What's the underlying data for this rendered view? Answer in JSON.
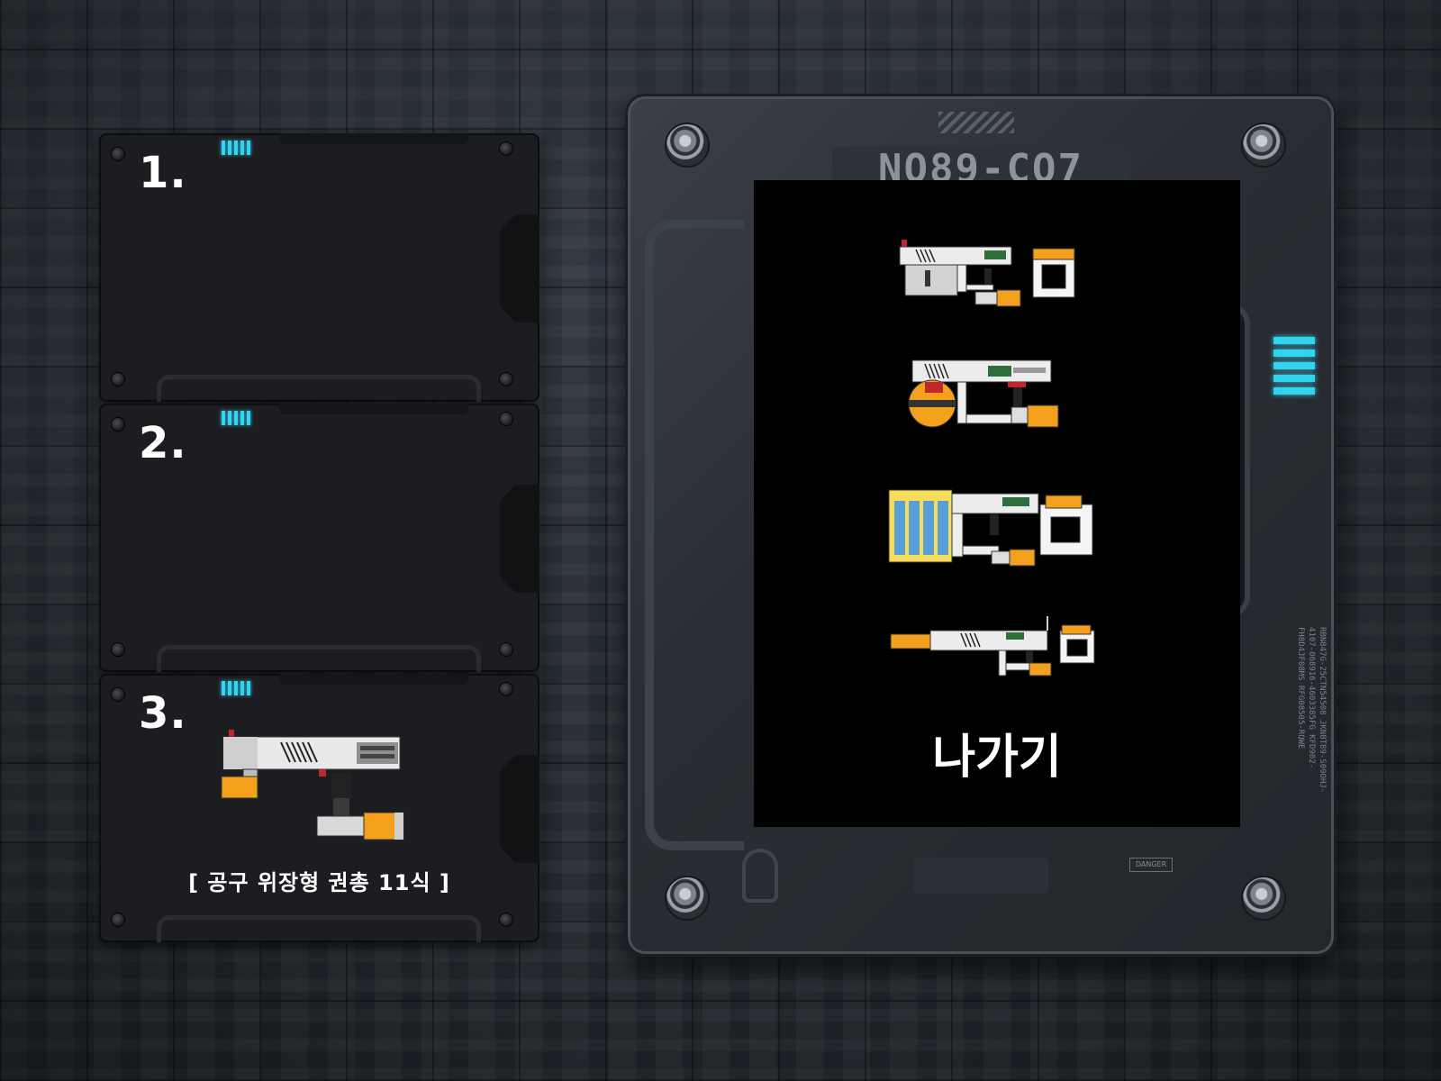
{
  "slots": [
    {
      "number": "1.",
      "caption": ""
    },
    {
      "number": "2.",
      "caption": ""
    },
    {
      "number": "3.",
      "caption": "[ 공구 위장형 권총 11식 ]"
    }
  ],
  "device": {
    "code": "NO89-CO7",
    "danger_label": "DANGER",
    "serial_text": "RBN847G-25CTN54508 JKN8T89-S09OHJ-4107-068916-4603385FG KFD902-FH8D4JF08MS RFG08505-RQWE"
  },
  "menu": {
    "weapons": [
      {
        "name": "weapon-1"
      },
      {
        "name": "weapon-2"
      },
      {
        "name": "weapon-3"
      },
      {
        "name": "weapon-4"
      }
    ],
    "exit_label": "나가기"
  },
  "colors": {
    "accent_led": "#33d3ef",
    "weapon_orange": "#f3a11d",
    "screen_bg": "#000000"
  },
  "icons": {
    "slot_screw": "screw-icon",
    "led": "led-indicator-icon"
  }
}
